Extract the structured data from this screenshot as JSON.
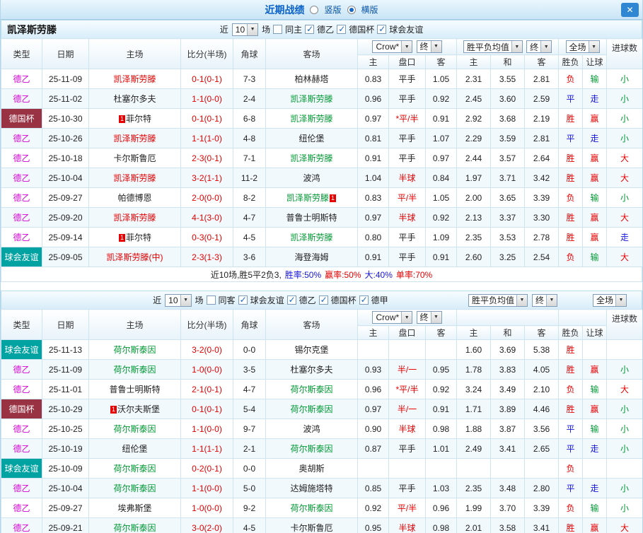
{
  "titlebar": {
    "title": "近期战绩",
    "radio_vertical": "竖版",
    "radio_horizontal": "横版",
    "close_icon": "✕"
  },
  "dropdowns": {
    "count": "10",
    "bookmaker": "Crow*",
    "final": "终",
    "avg": "胜平负均值",
    "fulltime": "全场"
  },
  "columns": {
    "type": "类型",
    "date": "日期",
    "home": "主场",
    "score": "比分(半场)",
    "corner": "角球",
    "away": "客场",
    "odds_home": "主",
    "odds_handicap": "盘口",
    "odds_away": "客",
    "avg_home": "主",
    "avg_draw": "和",
    "avg_away": "客",
    "result_wdl": "胜负",
    "result_handicap": "让球",
    "result_goals": "进球数"
  },
  "colors": {
    "accent_blue": "#0a62c9",
    "focus_home_red": "#e60000",
    "focus_away_green": "#009933",
    "league_magenta": "#d800d8",
    "league_cup_bg": "#993344",
    "league_friendly_bg": "#00a2a2",
    "result_blue": "#1414dd"
  },
  "tables": [
    {
      "team": "凯泽斯劳滕",
      "filter": {
        "near": "近",
        "matches": "场",
        "same": {
          "label": "同主",
          "checked": false
        },
        "leagues": [
          {
            "label": "德乙",
            "checked": true
          },
          {
            "label": "德国杯",
            "checked": true
          },
          {
            "label": "球会友谊",
            "checked": true
          }
        ]
      },
      "rows": [
        {
          "league": "德乙",
          "style": "magenta",
          "date": "25-11-09",
          "home": {
            "name": "凯泽斯劳滕",
            "color": "red"
          },
          "score": "0-1(0-1)",
          "corner": "7-3",
          "away": {
            "name": "柏林赫塔",
            "color": "black"
          },
          "odds": [
            "0.83",
            "平手",
            "1.05"
          ],
          "hot": false,
          "avg": [
            "2.31",
            "3.55",
            "2.81"
          ],
          "res": [
            [
              "负",
              "red"
            ],
            [
              "输",
              "green"
            ],
            [
              "小",
              "green"
            ]
          ]
        },
        {
          "league": "德乙",
          "style": "magenta",
          "date": "25-11-02",
          "home": {
            "name": "杜塞尔多夫",
            "color": "black"
          },
          "score": "1-1(0-0)",
          "corner": "2-4",
          "away": {
            "name": "凯泽斯劳滕",
            "color": "green"
          },
          "odds": [
            "0.96",
            "平手",
            "0.92"
          ],
          "hot": false,
          "avg": [
            "2.45",
            "3.60",
            "2.59"
          ],
          "res": [
            [
              "平",
              "blue"
            ],
            [
              "走",
              "blue"
            ],
            [
              "小",
              "green"
            ]
          ]
        },
        {
          "league": "德国杯",
          "style": "darkred",
          "date": "25-10-30",
          "home": {
            "name": "菲尔特",
            "color": "black",
            "badge_before": "1"
          },
          "score": "0-1(0-1)",
          "corner": "6-8",
          "away": {
            "name": "凯泽斯劳滕",
            "color": "green"
          },
          "odds": [
            "0.97",
            "*平/半",
            "0.91"
          ],
          "hot": true,
          "avg": [
            "2.92",
            "3.68",
            "2.19"
          ],
          "res": [
            [
              "胜",
              "red"
            ],
            [
              "赢",
              "red"
            ],
            [
              "小",
              "green"
            ]
          ]
        },
        {
          "league": "德乙",
          "style": "magenta",
          "date": "25-10-26",
          "home": {
            "name": "凯泽斯劳滕",
            "color": "red"
          },
          "score": "1-1(1-0)",
          "corner": "4-8",
          "away": {
            "name": "纽伦堡",
            "color": "black"
          },
          "odds": [
            "0.81",
            "平手",
            "1.07"
          ],
          "hot": false,
          "avg": [
            "2.29",
            "3.59",
            "2.81"
          ],
          "res": [
            [
              "平",
              "blue"
            ],
            [
              "走",
              "blue"
            ],
            [
              "小",
              "green"
            ]
          ]
        },
        {
          "league": "德乙",
          "style": "magenta",
          "date": "25-10-18",
          "home": {
            "name": "卡尔斯鲁厄",
            "color": "black"
          },
          "score": "2-3(0-1)",
          "corner": "7-1",
          "away": {
            "name": "凯泽斯劳滕",
            "color": "green"
          },
          "odds": [
            "0.91",
            "平手",
            "0.97"
          ],
          "hot": false,
          "avg": [
            "2.44",
            "3.57",
            "2.64"
          ],
          "res": [
            [
              "胜",
              "red"
            ],
            [
              "赢",
              "red"
            ],
            [
              "大",
              "red"
            ]
          ]
        },
        {
          "league": "德乙",
          "style": "magenta",
          "date": "25-10-04",
          "home": {
            "name": "凯泽斯劳滕",
            "color": "red"
          },
          "score": "3-2(1-1)",
          "corner": "11-2",
          "away": {
            "name": "波鸿",
            "color": "black"
          },
          "odds": [
            "1.04",
            "半球",
            "0.84"
          ],
          "hot": true,
          "avg": [
            "1.97",
            "3.71",
            "3.42"
          ],
          "res": [
            [
              "胜",
              "red"
            ],
            [
              "赢",
              "red"
            ],
            [
              "大",
              "red"
            ]
          ]
        },
        {
          "league": "德乙",
          "style": "magenta",
          "date": "25-09-27",
          "home": {
            "name": "帕德博恩",
            "color": "black"
          },
          "score": "2-0(0-0)",
          "corner": "8-2",
          "away": {
            "name": "凯泽斯劳滕",
            "color": "green",
            "badge_after": "1"
          },
          "odds": [
            "0.83",
            "平/半",
            "1.05"
          ],
          "hot": true,
          "avg": [
            "2.00",
            "3.65",
            "3.39"
          ],
          "res": [
            [
              "负",
              "red"
            ],
            [
              "输",
              "green"
            ],
            [
              "小",
              "green"
            ]
          ]
        },
        {
          "league": "德乙",
          "style": "magenta",
          "date": "25-09-20",
          "home": {
            "name": "凯泽斯劳滕",
            "color": "red"
          },
          "score": "4-1(3-0)",
          "corner": "4-7",
          "away": {
            "name": "普鲁士明斯特",
            "color": "black"
          },
          "odds": [
            "0.97",
            "半球",
            "0.92"
          ],
          "hot": true,
          "avg": [
            "2.13",
            "3.37",
            "3.30"
          ],
          "res": [
            [
              "胜",
              "red"
            ],
            [
              "赢",
              "red"
            ],
            [
              "大",
              "red"
            ]
          ]
        },
        {
          "league": "德乙",
          "style": "magenta",
          "date": "25-09-14",
          "home": {
            "name": "菲尔特",
            "color": "black",
            "badge_before": "1"
          },
          "score": "0-3(0-1)",
          "corner": "4-5",
          "away": {
            "name": "凯泽斯劳滕",
            "color": "green"
          },
          "odds": [
            "0.80",
            "平手",
            "1.09"
          ],
          "hot": false,
          "avg": [
            "2.35",
            "3.53",
            "2.78"
          ],
          "res": [
            [
              "胜",
              "red"
            ],
            [
              "赢",
              "red"
            ],
            [
              "走",
              "blue"
            ]
          ]
        },
        {
          "league": "球会友谊",
          "style": "teal",
          "date": "25-09-05",
          "home": {
            "name": "凯泽斯劳滕(中)",
            "color": "red"
          },
          "score": "2-3(1-3)",
          "corner": "3-6",
          "away": {
            "name": "海登海姆",
            "color": "black"
          },
          "odds": [
            "0.91",
            "平手",
            "0.91"
          ],
          "hot": false,
          "avg": [
            "2.60",
            "3.25",
            "2.54"
          ],
          "res": [
            [
              "负",
              "red"
            ],
            [
              "输",
              "green"
            ],
            [
              "大",
              "red"
            ]
          ]
        }
      ],
      "summary": [
        [
          "近10场,胜5平2负3,",
          "black"
        ],
        [
          "胜率:50%",
          "blue"
        ],
        [
          "赢率:50%",
          "red"
        ],
        [
          "大:40%",
          "blue"
        ],
        [
          "单率:70%",
          "red"
        ]
      ]
    },
    {
      "team": "",
      "filter": {
        "near": "近",
        "matches": "场",
        "same": {
          "label": "同客",
          "checked": false
        },
        "leagues": [
          {
            "label": "球会友谊",
            "checked": true
          },
          {
            "label": "德乙",
            "checked": true
          },
          {
            "label": "德国杯",
            "checked": true
          },
          {
            "label": "德甲",
            "checked": true
          }
        ]
      },
      "rows": [
        {
          "league": "球会友谊",
          "style": "teal",
          "date": "25-11-13",
          "home": {
            "name": "荷尔斯泰因",
            "color": "green"
          },
          "score": "3-2(0-0)",
          "corner": "0-0",
          "away": {
            "name": "锡尔克堡",
            "color": "black"
          },
          "odds": [
            "",
            "",
            ""
          ],
          "hot": false,
          "avg": [
            "1.60",
            "3.69",
            "5.38"
          ],
          "res": [
            [
              "胜",
              "red"
            ],
            [
              "",
              ""
            ],
            [
              "",
              ""
            ]
          ]
        },
        {
          "league": "德乙",
          "style": "magenta",
          "date": "25-11-09",
          "home": {
            "name": "荷尔斯泰因",
            "color": "green"
          },
          "score": "1-0(0-0)",
          "corner": "3-5",
          "away": {
            "name": "杜塞尔多夫",
            "color": "black"
          },
          "odds": [
            "0.93",
            "半/一",
            "0.95"
          ],
          "hot": true,
          "avg": [
            "1.78",
            "3.83",
            "4.05"
          ],
          "res": [
            [
              "胜",
              "red"
            ],
            [
              "赢",
              "red"
            ],
            [
              "小",
              "green"
            ]
          ]
        },
        {
          "league": "德乙",
          "style": "magenta",
          "date": "25-11-01",
          "home": {
            "name": "普鲁士明斯特",
            "color": "black"
          },
          "score": "2-1(0-1)",
          "corner": "4-7",
          "away": {
            "name": "荷尔斯泰因",
            "color": "green"
          },
          "odds": [
            "0.96",
            "*平/半",
            "0.92"
          ],
          "hot": true,
          "avg": [
            "3.24",
            "3.49",
            "2.10"
          ],
          "res": [
            [
              "负",
              "red"
            ],
            [
              "输",
              "green"
            ],
            [
              "大",
              "red"
            ]
          ]
        },
        {
          "league": "德国杯",
          "style": "darkred",
          "date": "25-10-29",
          "home": {
            "name": "沃尔夫斯堡",
            "color": "black",
            "badge_before": "1"
          },
          "score": "0-1(0-1)",
          "corner": "5-4",
          "away": {
            "name": "荷尔斯泰因",
            "color": "green"
          },
          "odds": [
            "0.97",
            "半/一",
            "0.91"
          ],
          "hot": true,
          "avg": [
            "1.71",
            "3.89",
            "4.46"
          ],
          "res": [
            [
              "胜",
              "red"
            ],
            [
              "赢",
              "red"
            ],
            [
              "小",
              "green"
            ]
          ]
        },
        {
          "league": "德乙",
          "style": "magenta",
          "date": "25-10-25",
          "home": {
            "name": "荷尔斯泰因",
            "color": "green"
          },
          "score": "1-1(0-0)",
          "corner": "9-7",
          "away": {
            "name": "波鸿",
            "color": "black"
          },
          "odds": [
            "0.90",
            "半球",
            "0.98"
          ],
          "hot": true,
          "avg": [
            "1.88",
            "3.87",
            "3.56"
          ],
          "res": [
            [
              "平",
              "blue"
            ],
            [
              "输",
              "green"
            ],
            [
              "小",
              "green"
            ]
          ]
        },
        {
          "league": "德乙",
          "style": "magenta",
          "date": "25-10-19",
          "home": {
            "name": "纽伦堡",
            "color": "black"
          },
          "score": "1-1(1-1)",
          "corner": "2-1",
          "away": {
            "name": "荷尔斯泰因",
            "color": "green"
          },
          "odds": [
            "0.87",
            "平手",
            "1.01"
          ],
          "hot": false,
          "avg": [
            "2.49",
            "3.41",
            "2.65"
          ],
          "res": [
            [
              "平",
              "blue"
            ],
            [
              "走",
              "blue"
            ],
            [
              "小",
              "green"
            ]
          ]
        },
        {
          "league": "球会友谊",
          "style": "teal",
          "date": "25-10-09",
          "home": {
            "name": "荷尔斯泰因",
            "color": "green"
          },
          "score": "0-2(0-1)",
          "corner": "0-0",
          "away": {
            "name": "奥胡斯",
            "color": "black"
          },
          "odds": [
            "",
            "",
            ""
          ],
          "hot": false,
          "avg": [
            "",
            "",
            ""
          ],
          "res": [
            [
              "负",
              "red"
            ],
            [
              "",
              ""
            ],
            [
              "",
              ""
            ]
          ]
        },
        {
          "league": "德乙",
          "style": "magenta",
          "date": "25-10-04",
          "home": {
            "name": "荷尔斯泰因",
            "color": "green"
          },
          "score": "1-1(0-0)",
          "corner": "5-0",
          "away": {
            "name": "达姆施塔特",
            "color": "black"
          },
          "odds": [
            "0.85",
            "平手",
            "1.03"
          ],
          "hot": false,
          "avg": [
            "2.35",
            "3.48",
            "2.80"
          ],
          "res": [
            [
              "平",
              "blue"
            ],
            [
              "走",
              "blue"
            ],
            [
              "小",
              "green"
            ]
          ]
        },
        {
          "league": "德乙",
          "style": "magenta",
          "date": "25-09-27",
          "home": {
            "name": "埃弗斯堡",
            "color": "black"
          },
          "score": "1-0(0-0)",
          "corner": "9-2",
          "away": {
            "name": "荷尔斯泰因",
            "color": "green"
          },
          "odds": [
            "0.92",
            "平/半",
            "0.96"
          ],
          "hot": true,
          "avg": [
            "1.99",
            "3.70",
            "3.39"
          ],
          "res": [
            [
              "负",
              "red"
            ],
            [
              "输",
              "green"
            ],
            [
              "小",
              "green"
            ]
          ]
        },
        {
          "league": "德乙",
          "style": "magenta",
          "date": "25-09-21",
          "home": {
            "name": "荷尔斯泰因",
            "color": "green"
          },
          "score": "3-0(2-0)",
          "corner": "4-5",
          "away": {
            "name": "卡尔斯鲁厄",
            "color": "black"
          },
          "odds": [
            "0.95",
            "半球",
            "0.98"
          ],
          "hot": true,
          "avg": [
            "2.01",
            "3.58",
            "3.41"
          ],
          "res": [
            [
              "胜",
              "red"
            ],
            [
              "赢",
              "red"
            ],
            [
              "大",
              "red"
            ]
          ]
        }
      ]
    }
  ]
}
